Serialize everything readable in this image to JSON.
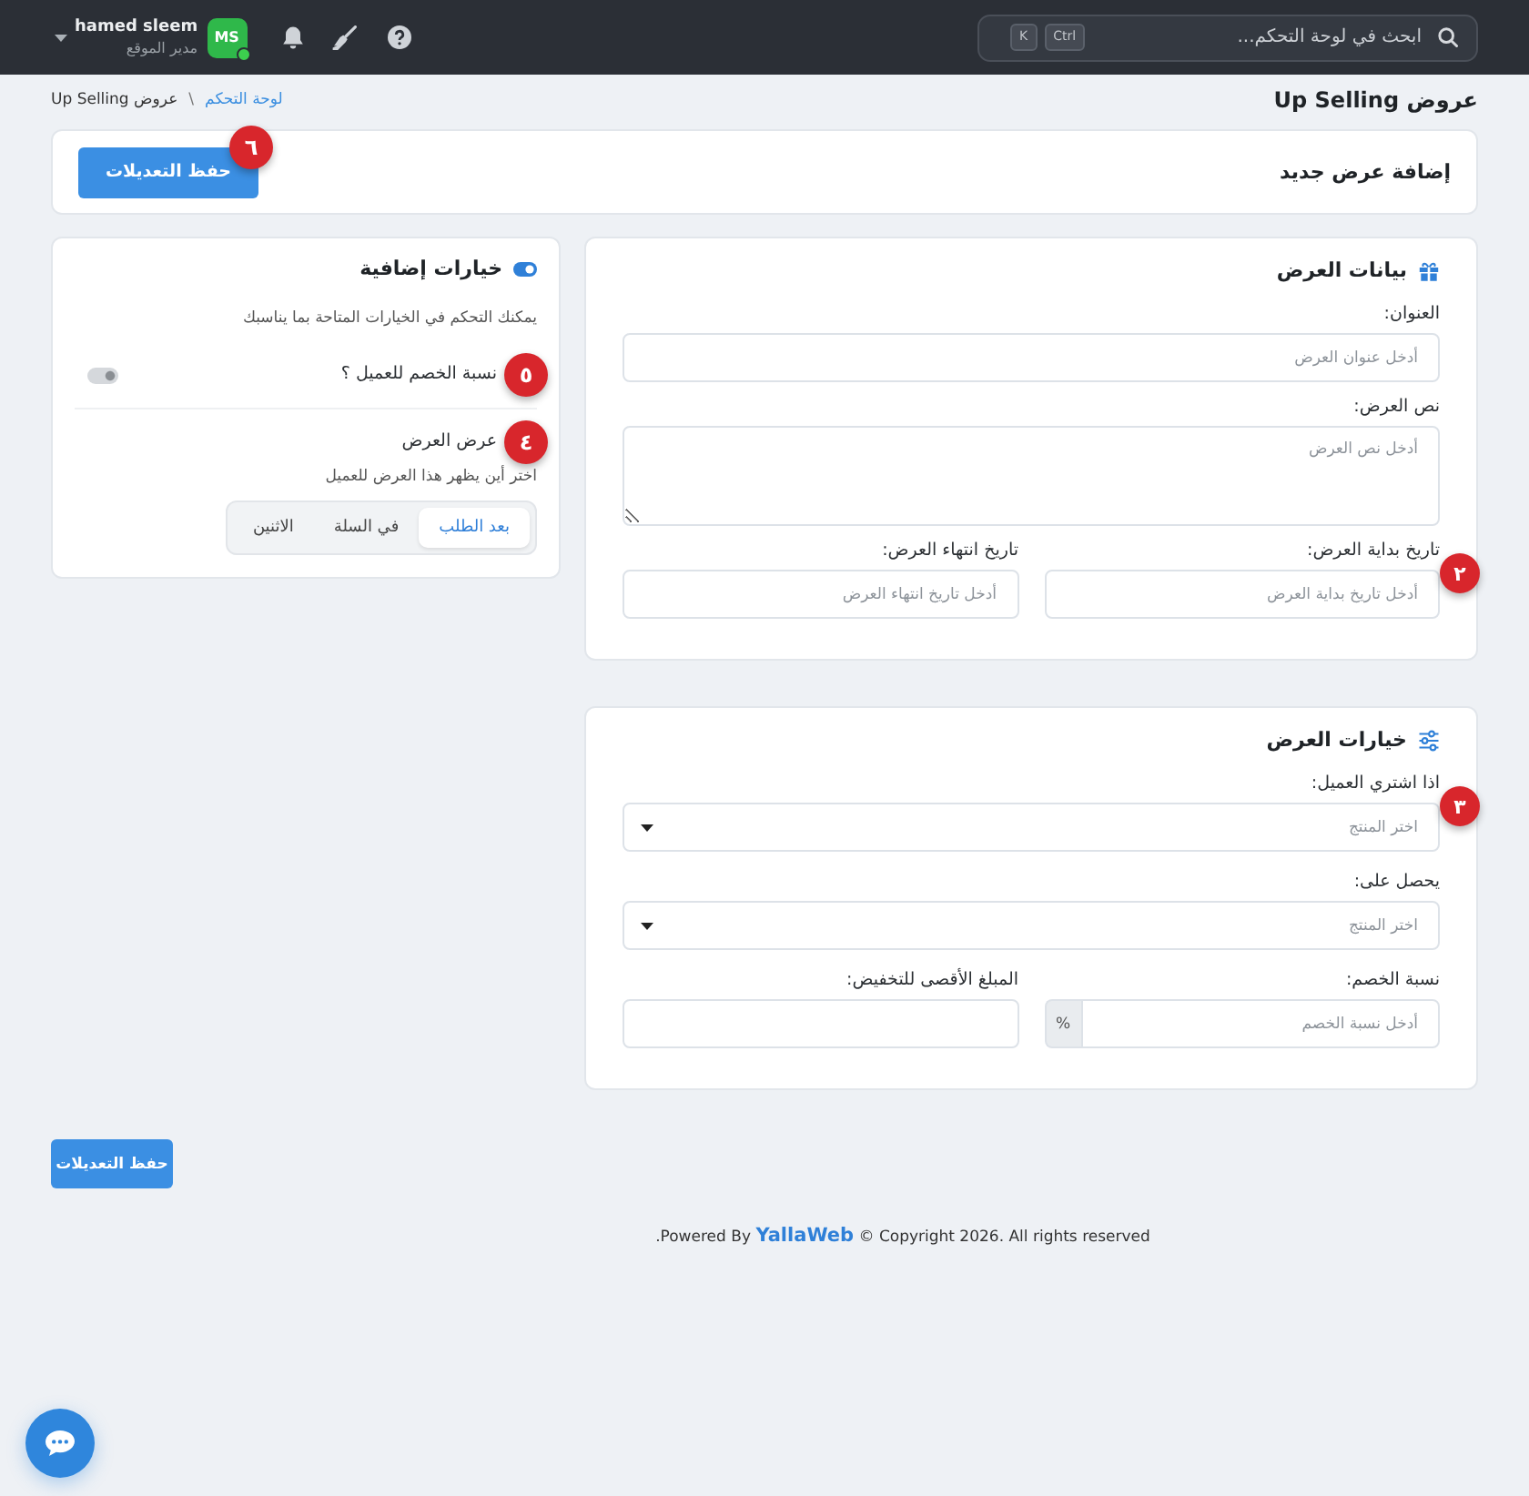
{
  "topbar": {
    "search": {
      "placeholder": "ابحث في لوحة التحكم...",
      "keys": [
        "Ctrl",
        "K"
      ]
    },
    "user": {
      "initials": "MS",
      "online": true,
      "name": "hamed sleem",
      "role": "مدير الموقع"
    }
  },
  "page": {
    "title": "عروض Up Selling",
    "breadcrumb": [
      {
        "label": "لوحة التحكم",
        "kind": "link"
      },
      {
        "label": "عروض Up Selling",
        "kind": "current"
      }
    ],
    "separator": "\\"
  },
  "header_card": {
    "title": "إضافة عرض جديد",
    "save_button": "حفظ التعديلات",
    "callout": "٦"
  },
  "offer_data": {
    "title": "بيانات العرض",
    "rows": [
      [
        {
          "kind": "text",
          "label": "العنوان:",
          "placeholder": "أدخل عنوان العرض"
        }
      ],
      [
        {
          "kind": "textarea",
          "label": "نص العرض:",
          "placeholder": "أدخل نص العرض"
        }
      ],
      [
        {
          "kind": "text",
          "label": "تاريخ بداية العرض:",
          "placeholder": "أدخل تاريخ بداية العرض",
          "callout": "٢"
        },
        {
          "kind": "text",
          "label": "تاريخ انتهاء العرض:",
          "placeholder": "أدخل تاريخ انتهاء العرض"
        }
      ]
    ]
  },
  "offer_options": {
    "title": "خيارات العرض",
    "rows": [
      [
        {
          "kind": "select",
          "label": "اذا اشتري العميل:",
          "placeholder": "اختر المنتج",
          "callout": "٣"
        }
      ],
      [
        {
          "kind": "select",
          "label": "يحصل على:",
          "placeholder": "اختر المنتج"
        }
      ],
      [
        {
          "kind": "addon",
          "label": "نسبة الخصم:",
          "placeholder": "أدخل نسبة الخصم",
          "addon": "%"
        },
        {
          "kind": "text",
          "label": "المبلغ الأقصى للتخفيض:"
        }
      ]
    ]
  },
  "extra_options": {
    "title": "خيارات إضافية",
    "description": "يمكنك التحكم في الخيارات المتاحة بما يناسبك",
    "settings": [
      {
        "kind": "switch",
        "label": "نسبة الخصم للعميل ؟",
        "on": false,
        "callout": "٥"
      },
      {
        "kind": "segmented",
        "label": "عرض العرض",
        "hint": "اختر أين يظهر هذا العرض للعميل",
        "callout": "٤",
        "options": [
          {
            "label": "بعد الطلب",
            "selected": true
          },
          {
            "label": "في السلة",
            "selected": false
          },
          {
            "label": "الاثنين",
            "selected": false
          }
        ]
      }
    ]
  },
  "bottom_save_button": "حفظ التعديلات",
  "footer": {
    "prefix": ".Powered By",
    "brand": "YallaWeb",
    "suffix": "© Copyright 2026. All rights reserved"
  }
}
